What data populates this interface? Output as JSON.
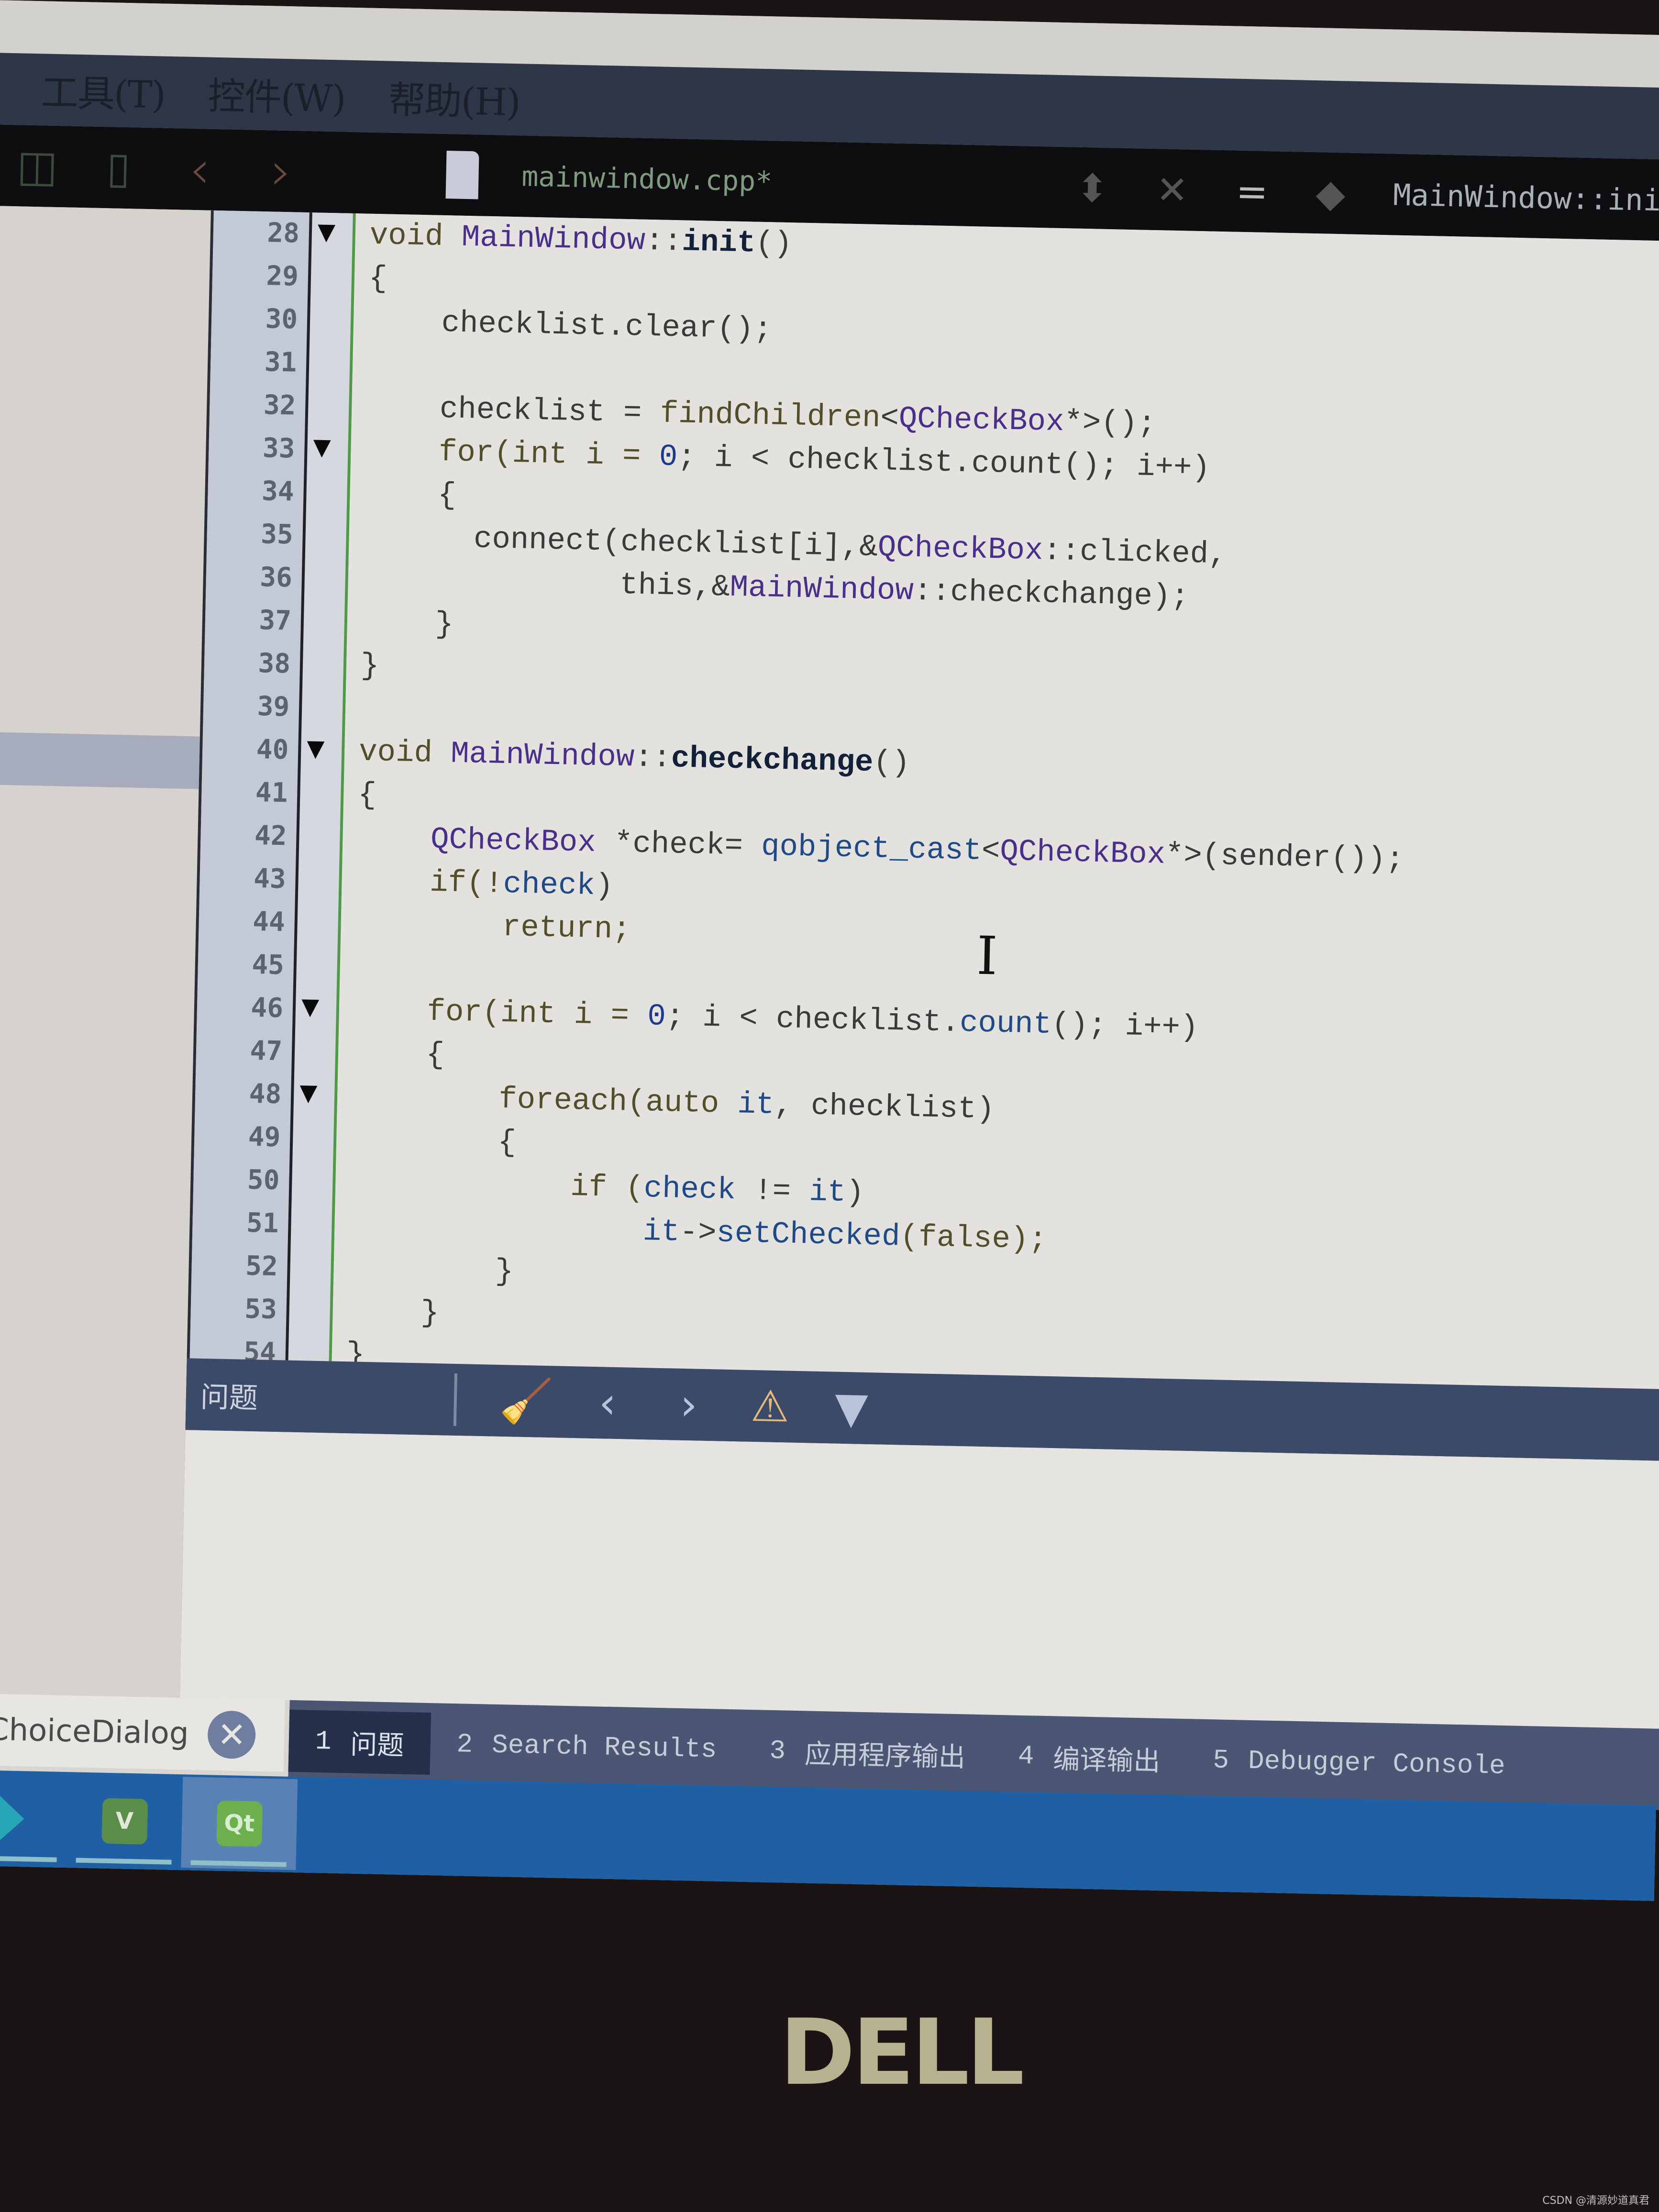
{
  "menu": {
    "items": [
      "工具(T)",
      "控件(W)",
      "帮助(H)"
    ]
  },
  "toolbar": {
    "back_icon": "‹",
    "forward_icon": "›",
    "file_name": "mainwindow.cpp*",
    "close_icon": "✕",
    "split_icon": "=",
    "function_name": "MainWindow::ini"
  },
  "editor": {
    "lines": [
      {
        "n": "28",
        "fold": true
      },
      {
        "n": "29",
        "fold": false
      },
      {
        "n": "30",
        "fold": false
      },
      {
        "n": "31",
        "fold": false
      },
      {
        "n": "32",
        "fold": false
      },
      {
        "n": "33",
        "fold": true
      },
      {
        "n": "34",
        "fold": false
      },
      {
        "n": "35",
        "fold": false
      },
      {
        "n": "36",
        "fold": false
      },
      {
        "n": "37",
        "fold": false
      },
      {
        "n": "38",
        "fold": false
      },
      {
        "n": "39",
        "fold": false
      },
      {
        "n": "40",
        "fold": true
      },
      {
        "n": "41",
        "fold": false
      },
      {
        "n": "42",
        "fold": false
      },
      {
        "n": "43",
        "fold": false
      },
      {
        "n": "44",
        "fold": false
      },
      {
        "n": "45",
        "fold": false
      },
      {
        "n": "46",
        "fold": true
      },
      {
        "n": "47",
        "fold": false
      },
      {
        "n": "48",
        "fold": true
      },
      {
        "n": "49",
        "fold": false
      },
      {
        "n": "50",
        "fold": false
      },
      {
        "n": "51",
        "fold": false
      },
      {
        "n": "52",
        "fold": false
      },
      {
        "n": "53",
        "fold": false
      },
      {
        "n": "54",
        "fold": false
      }
    ],
    "code": {
      "l28a": "void ",
      "l28b": "MainWindow",
      "l28c": "::",
      "l28d": "init",
      "l28e": "()",
      "l29": "{",
      "l30": "    checklist.clear();",
      "l32a": "    checklist = ",
      "l32b": "findChildren",
      "l32c": "<",
      "l32d": "QCheckBox",
      "l32e": "*>();",
      "l33a": "    for(int i = ",
      "l33b": "0",
      "l33c": "; i < checklist.count(); i++)",
      "l34": "    {",
      "l35a": "      connect(checklist[i],&",
      "l35b": "QCheckBox",
      "l35c": "::clicked,",
      "l36a": "              this,&",
      "l36b": "MainWindow",
      "l36c": "::checkchange);",
      "l37": "    }",
      "l38": "}",
      "l40a": "void ",
      "l40b": "MainWindow",
      "l40c": "::",
      "l40d": "checkchange",
      "l40e": "()",
      "l41": "{",
      "l42a": "    ",
      "l42b": "QCheckBox",
      "l42c": " *check= ",
      "l42d": "qobject_cast",
      "l42e": "<",
      "l42f": "QCheckBox",
      "l42g": "*>(sender());",
      "l43a": "    if(!",
      "l43b": "check",
      "l43c": ")",
      "l44": "        return;",
      "l46a": "    for(int i = ",
      "l46b": "0",
      "l46c": "; i < checklist.",
      "l46d": "count",
      "l46e": "(); i++)",
      "l47": "    {",
      "l48a": "        foreach(auto ",
      "l48b": "it",
      "l48c": ", checklist)",
      "l49": "        {",
      "l50a": "            if (",
      "l50b": "check",
      "l50c": " != ",
      "l50d": "it",
      "l50e": ")",
      "l51a": "                ",
      "l51b": "it",
      "l51c": "->",
      "l51d": "setChecked",
      "l51e": "(false);",
      "l52": "        }",
      "l53": "    }",
      "l54": "}"
    },
    "cursor_glyph": "I"
  },
  "issues_panel": {
    "title": "问题",
    "icons": [
      "clean-icon",
      "prev-icon",
      "next-icon",
      "warning-icon",
      "filter-icon"
    ],
    "prev": "‹",
    "next": "›",
    "warn": "⚠",
    "filter": "▼"
  },
  "bottom": {
    "open_file": "onChoiceDialog",
    "close_glyph": "✕",
    "tabs": [
      {
        "num": "1",
        "label": "问题",
        "active": true
      },
      {
        "num": "2",
        "label": "Search Results",
        "active": false
      },
      {
        "num": "3",
        "label": "应用程序输出",
        "active": false
      },
      {
        "num": "4",
        "label": "编译输出",
        "active": false
      },
      {
        "num": "5",
        "label": "Debugger Console",
        "active": false
      }
    ]
  },
  "taskbar": {
    "apps": [
      {
        "name": "arrow-app"
      },
      {
        "name": "vs-app",
        "glyph": "V"
      },
      {
        "name": "qt-creator-app",
        "glyph": "Qt"
      }
    ]
  },
  "bezel": {
    "brand": "DELL"
  },
  "watermark": "CSDN @清源妙道真君",
  "colors": {
    "accent_menubar": "#2e3747",
    "issues_bar": "#3b4a68",
    "taskbar": "#1f5fa3",
    "warning": "#e6b87c",
    "gutter_change": "#4f9a46"
  }
}
